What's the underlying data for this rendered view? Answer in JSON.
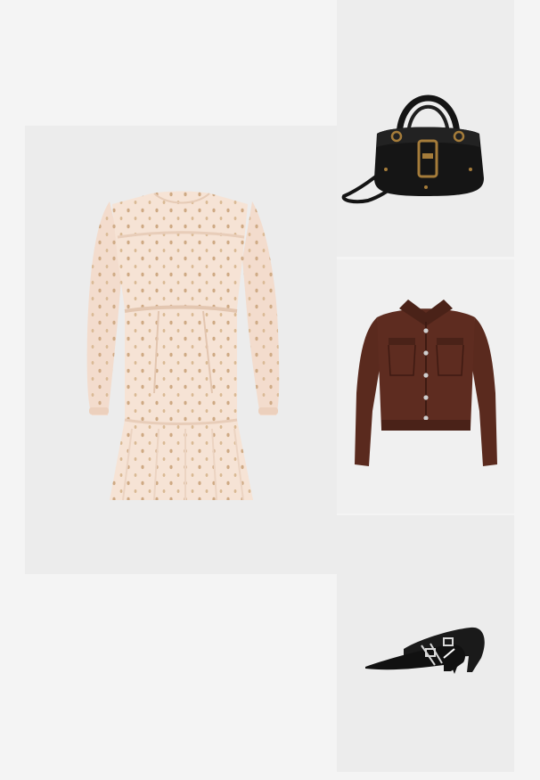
{
  "colors": {
    "page_bg": "#f4f4f4",
    "tile_bg": "#ececec",
    "dress_fabric": "#f4dfd0",
    "dress_dots": "#c9a27a",
    "bag_leather": "#151515",
    "bag_hardware": "#a57c3a",
    "jacket_corduroy": "#5a2a1e",
    "shoe_leather": "#111111",
    "shoe_hardware": "#d8d8d8"
  },
  "products": [
    {
      "name": "dress",
      "icon": "cream-polka-dot-tiered-dress-image"
    },
    {
      "name": "bag",
      "icon": "black-leather-buckle-handbag-image"
    },
    {
      "name": "jacket",
      "icon": "brown-corduroy-cropped-jacket-image"
    },
    {
      "name": "shoes",
      "icon": "black-buckle-kitten-heel-pumps-image"
    }
  ]
}
